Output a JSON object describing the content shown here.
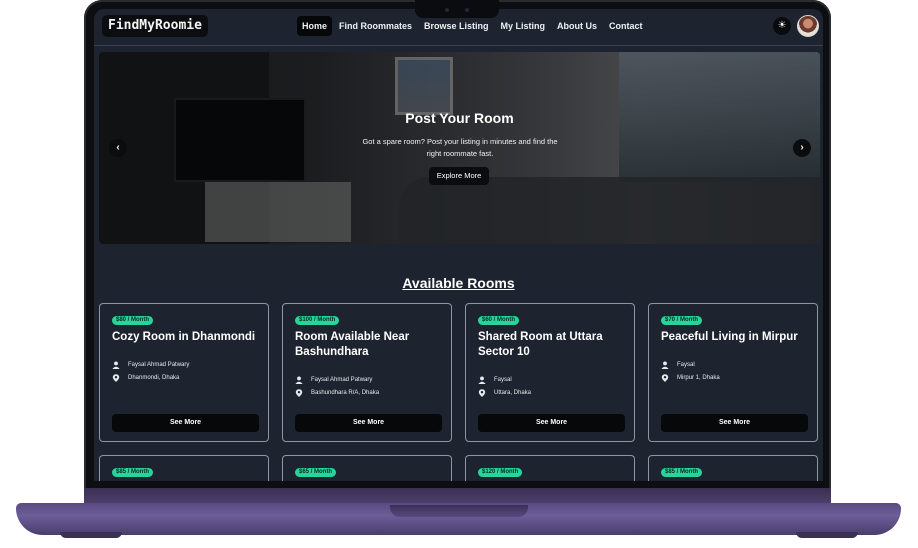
{
  "nav": {
    "logo": "FindMyRoomie",
    "links": [
      {
        "label": "Home",
        "active": true
      },
      {
        "label": "Find Roommates",
        "active": false
      },
      {
        "label": "Browse Listing",
        "active": false
      },
      {
        "label": "My Listing",
        "active": false
      },
      {
        "label": "About Us",
        "active": false
      },
      {
        "label": "Contact",
        "active": false
      }
    ],
    "theme_icon": "sun-icon"
  },
  "hero": {
    "title": "Post Your Room",
    "text": "Got a spare room? Post your listing in minutes and find the right roommate fast.",
    "button": "Explore More"
  },
  "section": {
    "title": "Available Rooms"
  },
  "cards": [
    {
      "price": "$80 / Month",
      "title": "Cozy Room in Dhanmondi",
      "owner": "Faysal Ahmad Patwary",
      "location": "Dhanmondi, Dhaka",
      "button": "See More"
    },
    {
      "price": "$100 / Month",
      "title": "Room Available Near Bashundhara",
      "owner": "Faysal Ahmad Patwary",
      "location": "Bashundhara R/A, Dhaka",
      "button": "See More"
    },
    {
      "price": "$60 / Month",
      "title": "Shared Room at Uttara Sector 10",
      "owner": "Faysal",
      "location": "Uttara, Dhaka",
      "button": "See More"
    },
    {
      "price": "$70 / Month",
      "title": "Peaceful Living in Mirpur",
      "owner": "Faysal",
      "location": "Mirpur 1, Dhaka",
      "button": "See More"
    }
  ],
  "next_cards": [
    {
      "price": "$85 / Month"
    },
    {
      "price": "$65 / Month"
    },
    {
      "price": "$120 / Month"
    },
    {
      "price": "$85 / Month"
    }
  ],
  "colors": {
    "accent": "#27d49b",
    "background": "#1d2430",
    "button": "#070809"
  }
}
